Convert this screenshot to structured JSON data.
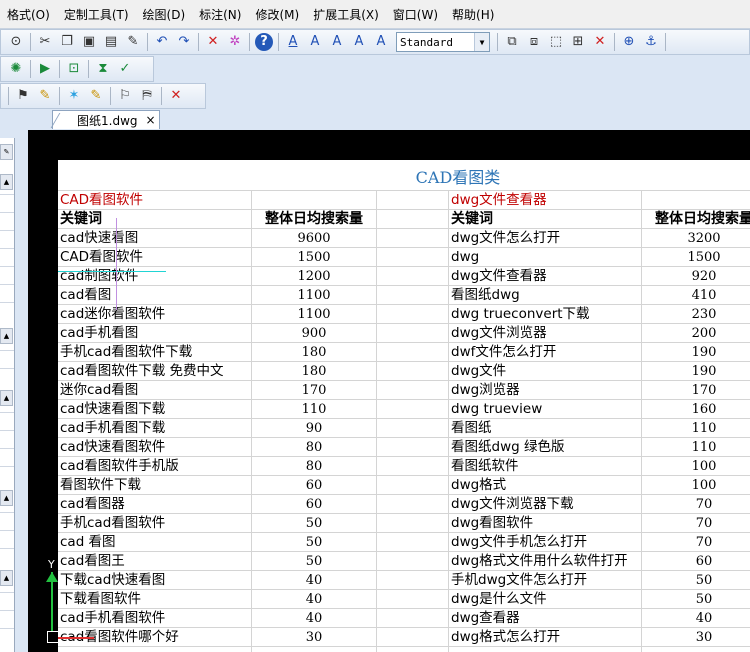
{
  "menubar": [
    "格式(O)",
    "定制工具(T)",
    "绘图(D)",
    "标注(N)",
    "修改(M)",
    "扩展工具(X)",
    "窗口(W)",
    "帮助(H)"
  ],
  "toolbar": {
    "text_style_value": "Standard"
  },
  "tab": {
    "label": "图纸1.dwg",
    "close": "×"
  },
  "ucs": {
    "y_label": "Y"
  },
  "sheet": {
    "title": "CAD看图类",
    "left": {
      "section": "CAD看图软件",
      "col_keyword": "关键词",
      "col_volume": "整体日均搜索量",
      "rows": [
        {
          "kw": "cad快速看图",
          "v": "9600"
        },
        {
          "kw": "CAD看图软件",
          "v": "1500"
        },
        {
          "kw": "cad制图软件",
          "v": "1200"
        },
        {
          "kw": "cad看图",
          "v": "1100"
        },
        {
          "kw": "cad迷你看图软件",
          "v": "1100"
        },
        {
          "kw": "cad手机看图",
          "v": "900"
        },
        {
          "kw": "手机cad看图软件下载",
          "v": "180"
        },
        {
          "kw": "cad看图软件下载 免费中文",
          "v": "180"
        },
        {
          "kw": "迷你cad看图",
          "v": "170"
        },
        {
          "kw": "cad快速看图下载",
          "v": "110"
        },
        {
          "kw": "cad手机看图下载",
          "v": "90"
        },
        {
          "kw": "cad快速看图软件",
          "v": "80"
        },
        {
          "kw": "cad看图软件手机版",
          "v": "80"
        },
        {
          "kw": "看图软件下载",
          "v": "60"
        },
        {
          "kw": "cad看图器",
          "v": "60"
        },
        {
          "kw": "手机cad看图软件",
          "v": "50"
        },
        {
          "kw": "cad 看图",
          "v": "50"
        },
        {
          "kw": "cad看图王",
          "v": "50"
        },
        {
          "kw": "下载cad快速看图",
          "v": "40"
        },
        {
          "kw": "下载看图软件",
          "v": "40"
        },
        {
          "kw": "cad手机看图软件",
          "v": "40"
        },
        {
          "kw": "cad看图软件哪个好",
          "v": "30"
        }
      ]
    },
    "right": {
      "section": "dwg文件查看器",
      "col_keyword": "关键词",
      "col_volume": "整体日均搜索量",
      "rows": [
        {
          "kw": "dwg文件怎么打开",
          "v": "3200"
        },
        {
          "kw": "dwg",
          "v": "1500"
        },
        {
          "kw": "dwg文件查看器",
          "v": "920"
        },
        {
          "kw": "看图纸dwg",
          "v": "410"
        },
        {
          "kw": "dwg trueconvert下载",
          "v": "230"
        },
        {
          "kw": "dwg文件浏览器",
          "v": "200"
        },
        {
          "kw": "dwf文件怎么打开",
          "v": "190"
        },
        {
          "kw": "dwg文件",
          "v": "190"
        },
        {
          "kw": "dwg浏览器",
          "v": "170"
        },
        {
          "kw": "dwg trueview",
          "v": "160"
        },
        {
          "kw": "看图纸",
          "v": "110"
        },
        {
          "kw": "看图纸dwg 绿色版",
          "v": "110"
        },
        {
          "kw": "看图纸软件",
          "v": "100"
        },
        {
          "kw": "dwg格式",
          "v": "100"
        },
        {
          "kw": "dwg文件浏览器下载",
          "v": "70"
        },
        {
          "kw": "dwg看图软件",
          "v": "70"
        },
        {
          "kw": "dwg文件手机怎么打开",
          "v": "70"
        },
        {
          "kw": "dwg格式文件用什么软件打开",
          "v": "60"
        },
        {
          "kw": "手机dwg文件怎么打开",
          "v": "50"
        },
        {
          "kw": "dwg是什么文件",
          "v": "50"
        },
        {
          "kw": "dwg查看器",
          "v": "40"
        },
        {
          "kw": "dwg格式怎么打开",
          "v": "30"
        }
      ]
    }
  },
  "colors": {
    "title": "#2e75b6",
    "section": "#c00000",
    "canvas": "#000000"
  }
}
